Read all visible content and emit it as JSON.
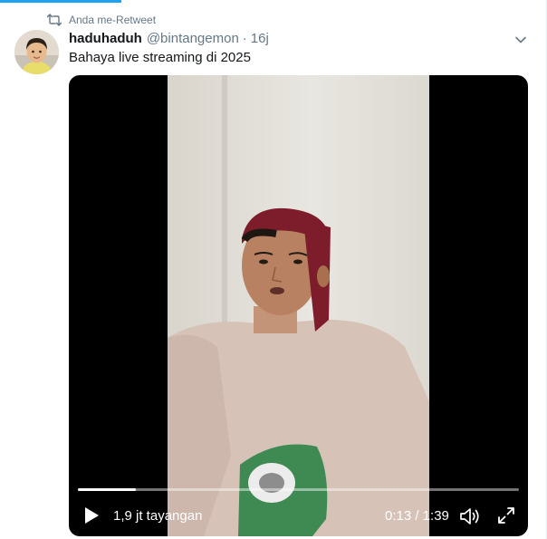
{
  "retweet": {
    "label": "Anda me-Retweet",
    "icon": "retweet-icon"
  },
  "tweet": {
    "display_name": "haduhaduh",
    "handle": "@bintangemon",
    "separator": "·",
    "time": "16j",
    "text": "Bahaya live streaming di 2025"
  },
  "video": {
    "views": "1,9 jt tayangan",
    "current_time": "0:13",
    "duration": "1:39",
    "timecode": "0:13 / 1:39",
    "progress_fraction": 0.131
  },
  "colors": {
    "accent": "#1da1f2",
    "muted_text": "#657786",
    "primary_text": "#14171a"
  },
  "icons": {
    "more": "chevron-down-icon",
    "play": "play-icon",
    "volume": "volume-icon",
    "fullscreen": "fullscreen-icon"
  }
}
